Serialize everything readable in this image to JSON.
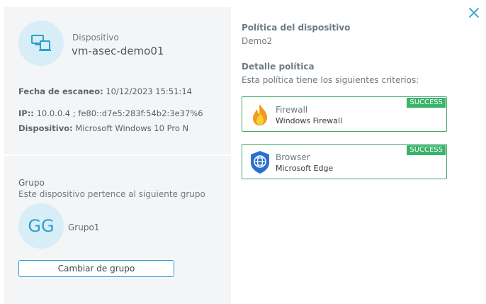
{
  "left": {
    "device_label": "Dispositivo",
    "device_name": "vm-asec-demo01",
    "scan_label": "Fecha de escaneo:",
    "scan_value": "10/12/2023 15:51:14",
    "ip_label": "IP::",
    "ip_value": "10.0.0.4 ; fe80::d7e5:283f:54b2:3e37%6",
    "os_label": "Dispositivo:",
    "os_value": "Microsoft Windows 10 Pro N",
    "group_title": "Grupo",
    "group_desc": "Este dispositivo pertence al siguiente grupo",
    "group_initials": "GG",
    "group_name": "Grupo1",
    "change_group_button": "Cambiar de grupo"
  },
  "right": {
    "policy_title": "Política del dispositivo",
    "policy_name": "Demo2",
    "detail_title": "Detalle política",
    "detail_desc": "Esta política tiene los siguientes criterios:",
    "criteria": [
      {
        "name": "Firewall",
        "detail": "Windows Firewall",
        "status": "SUCCESS",
        "icon": "flame-icon"
      },
      {
        "name": "Browser",
        "detail": "Microsoft Edge",
        "status": "SUCCESS",
        "icon": "globe-shield-icon"
      }
    ]
  },
  "colors": {
    "accent": "#2f9fce",
    "success": "#3bb36a",
    "panel_bg": "#f4f5f6"
  },
  "icons": {
    "device": "computer-devices-icon",
    "close": "close-icon"
  }
}
